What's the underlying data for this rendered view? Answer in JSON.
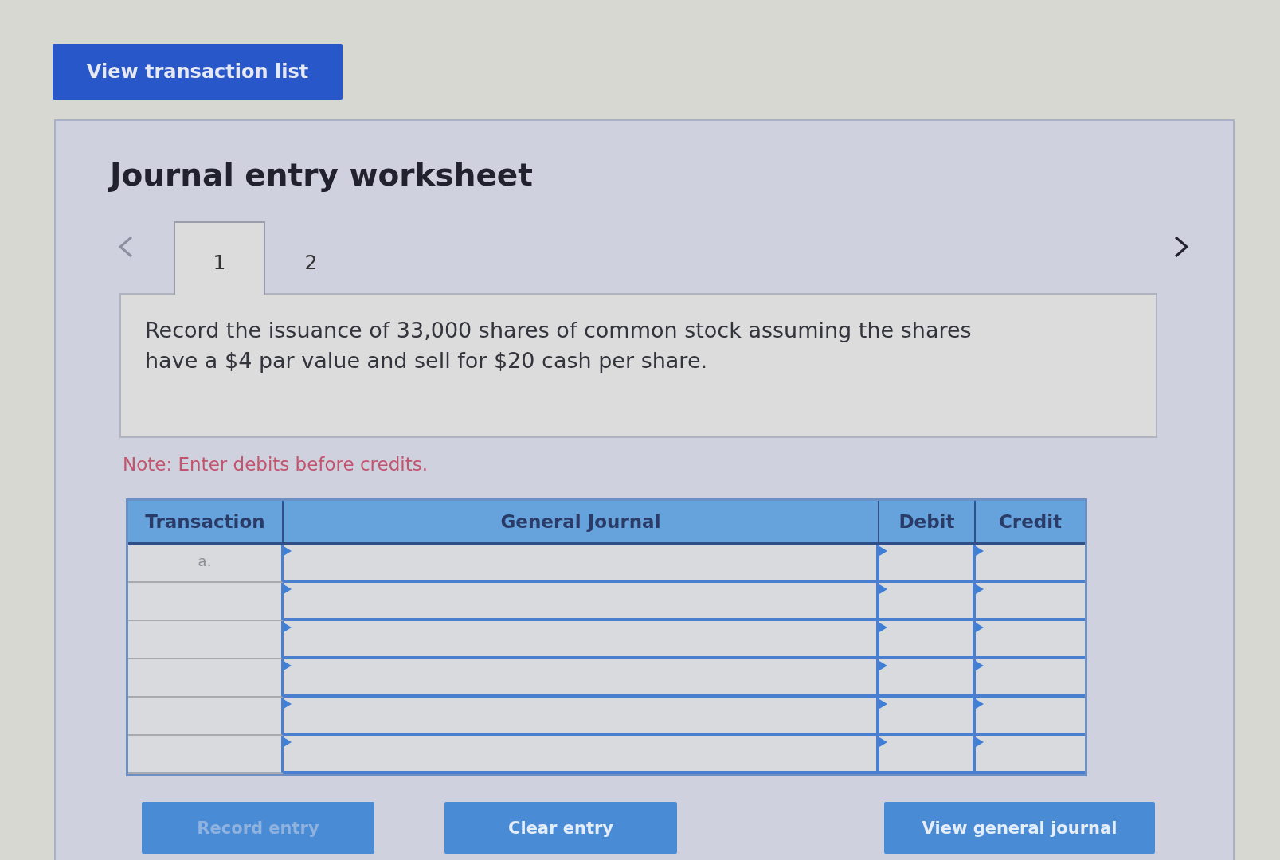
{
  "top_button": {
    "label": "View transaction list"
  },
  "worksheet": {
    "title": "Journal entry worksheet",
    "pager": {
      "previous": {
        "disabled": true
      },
      "next": {
        "disabled": false
      },
      "tabs": [
        {
          "label": "1",
          "selected": true
        },
        {
          "label": "2",
          "selected": false
        }
      ]
    },
    "question": "Record the issuance of 33,000 shares of common stock assuming the shares have a $4 par value and sell for $20 cash per share.",
    "note": "Note: Enter debits before credits.",
    "table": {
      "columns": [
        "Transaction",
        "General Journal",
        "Debit",
        "Credit"
      ],
      "rows": [
        {
          "transaction": "a."
        },
        {},
        {},
        {},
        {},
        {}
      ]
    },
    "buttons": [
      {
        "label": "Record entry",
        "disabled": true
      },
      {
        "label": "Clear entry",
        "disabled": false
      },
      {
        "label": "View general journal",
        "disabled": false
      }
    ]
  }
}
